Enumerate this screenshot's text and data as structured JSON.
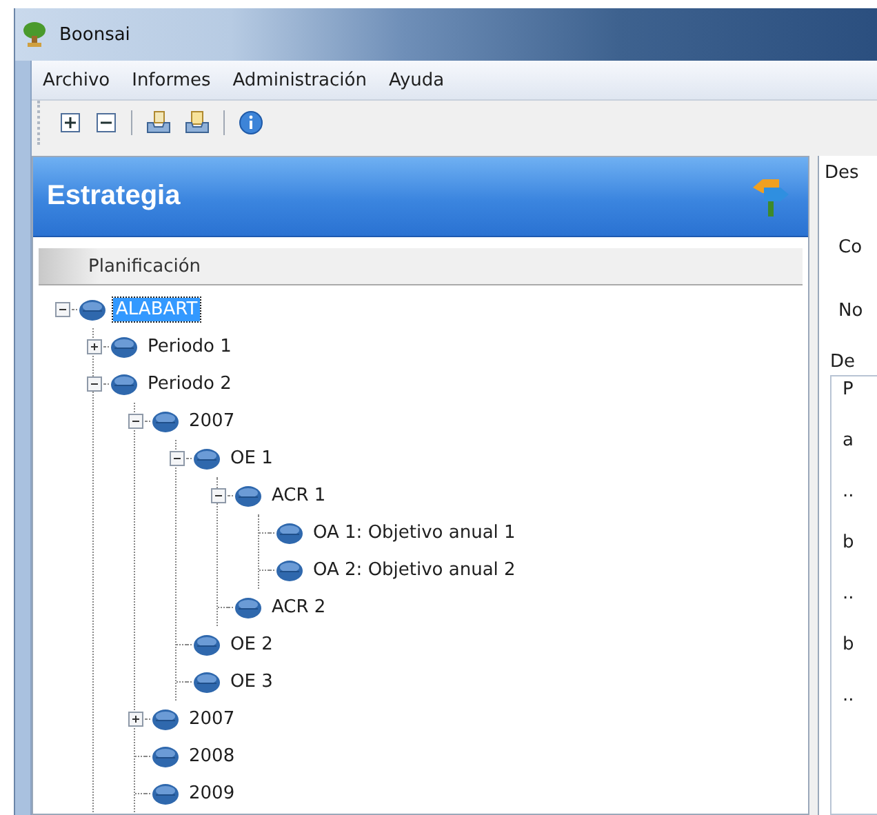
{
  "window": {
    "title": "Boonsai"
  },
  "menu": [
    "Archivo",
    "Informes",
    "Administración",
    "Ayuda"
  ],
  "toolbar": [
    {
      "kind": "expand"
    },
    {
      "kind": "collapse"
    },
    {
      "kind": "separator"
    },
    {
      "kind": "import"
    },
    {
      "kind": "export"
    },
    {
      "kind": "separator"
    },
    {
      "kind": "info"
    }
  ],
  "panel": {
    "title": "Estrategia",
    "column": "Planificación"
  },
  "tree": [
    {
      "label": "ALABART",
      "selected": true,
      "expanded": true,
      "children": [
        {
          "label": "Periodo 1",
          "selected": false,
          "expanded": false
        },
        {
          "label": "Periodo 2",
          "selected": false,
          "expanded": true,
          "children": [
            {
              "label": "2007",
              "selected": false,
              "expanded": true,
              "children": [
                {
                  "label": "OE 1",
                  "selected": false,
                  "expanded": true,
                  "children": [
                    {
                      "label": "ACR 1",
                      "selected": false,
                      "expanded": true,
                      "children": [
                        {
                          "label": "OA 1: Objetivo anual 1",
                          "selected": false
                        },
                        {
                          "label": "OA 2: Objetivo anual 2",
                          "selected": false
                        }
                      ]
                    },
                    {
                      "label": "ACR 2",
                      "selected": false
                    }
                  ]
                },
                {
                  "label": "OE 2",
                  "selected": false
                },
                {
                  "label": "OE 3",
                  "selected": false
                }
              ]
            },
            {
              "label": "2007",
              "selected": false,
              "expanded": false
            },
            {
              "label": "2008",
              "selected": false
            },
            {
              "label": "2009",
              "selected": false
            }
          ]
        }
      ]
    }
  ],
  "detail": {
    "tab": "Des",
    "labels": [
      "Co",
      "No",
      "De"
    ],
    "text_lines": [
      "P",
      "a",
      "..",
      "b",
      "..",
      "b",
      ".."
    ]
  }
}
